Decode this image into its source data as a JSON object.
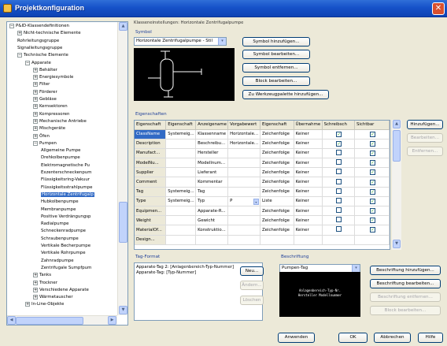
{
  "window": {
    "title": "Projektkonfiguration",
    "close_glyph": "✕"
  },
  "tree": {
    "items": [
      {
        "label": "P&ID-Klassendefinitionen",
        "level": 0,
        "expander": "−"
      },
      {
        "label": "Nicht-technische Elemente",
        "level": 1,
        "expander": "+"
      },
      {
        "label": "Rohrleitungsgruppe",
        "level": 1,
        "expander": ""
      },
      {
        "label": "Signalleitungsgruppe",
        "level": 1,
        "expander": ""
      },
      {
        "label": "Technische Elemente",
        "level": 1,
        "expander": "−"
      },
      {
        "label": "Apparate",
        "level": 2,
        "expander": "−"
      },
      {
        "label": "Behälter",
        "level": 3,
        "expander": "+"
      },
      {
        "label": "Energiesymbole",
        "level": 3,
        "expander": "+"
      },
      {
        "label": "Filter",
        "level": 3,
        "expander": "+"
      },
      {
        "label": "Förderer",
        "level": 3,
        "expander": "+"
      },
      {
        "label": "Gebläse",
        "level": 3,
        "expander": "+"
      },
      {
        "label": "Kernsektoren",
        "level": 3,
        "expander": "+"
      },
      {
        "label": "Kompressoren",
        "level": 3,
        "expander": "+"
      },
      {
        "label": "Mechanische Antriebe",
        "level": 3,
        "expander": "+"
      },
      {
        "label": "Mischgeräte",
        "level": 3,
        "expander": "+"
      },
      {
        "label": "Öfen",
        "level": 3,
        "expander": "+"
      },
      {
        "label": "Pumpen",
        "level": 3,
        "expander": "−"
      },
      {
        "label": "Allgemeine Pumpe",
        "level": 4,
        "expander": ""
      },
      {
        "label": "Drehkolbenpumpe",
        "level": 4,
        "expander": ""
      },
      {
        "label": "Elektromagnetische Pu",
        "level": 4,
        "expander": ""
      },
      {
        "label": "Exzenterschneckenpum",
        "level": 4,
        "expander": ""
      },
      {
        "label": "Flüssigkeitsring-Vakuur",
        "level": 4,
        "expander": ""
      },
      {
        "label": "Flüssigkeitsstrahlpumpe",
        "level": 4,
        "expander": ""
      },
      {
        "label": "Horizontale Zentrifugalp",
        "level": 4,
        "expander": "",
        "selected": true
      },
      {
        "label": "Hubkolbenpumpe",
        "level": 4,
        "expander": ""
      },
      {
        "label": "Membranpumpe",
        "level": 4,
        "expander": ""
      },
      {
        "label": "Positive Verdrängungsp",
        "level": 4,
        "expander": ""
      },
      {
        "label": "Radialpumpe",
        "level": 4,
        "expander": ""
      },
      {
        "label": "Schneckenradpumpe",
        "level": 4,
        "expander": ""
      },
      {
        "label": "Schraubenpumpe",
        "level": 4,
        "expander": ""
      },
      {
        "label": "Vertikale Becherpumpe",
        "level": 4,
        "expander": ""
      },
      {
        "label": "Vertikale Rohrpumpe",
        "level": 4,
        "expander": ""
      },
      {
        "label": "Zahnradpumpe",
        "level": 4,
        "expander": ""
      },
      {
        "label": "Zentrifugale Sumpfpum",
        "level": 4,
        "expander": ""
      },
      {
        "label": "Tanks",
        "level": 3,
        "expander": "+"
      },
      {
        "label": "Trockner",
        "level": 3,
        "expander": "+"
      },
      {
        "label": "Verschiedene Apparate",
        "level": 3,
        "expander": "+"
      },
      {
        "label": "Wärmetauscher",
        "level": 3,
        "expander": "+"
      },
      {
        "label": "In-Line-Objekte",
        "level": 2,
        "expander": "+"
      }
    ]
  },
  "breadcrumb": "Klasseneinstellungen: Horizontale Zentrifugalpumpe",
  "symbol": {
    "group_label": "Symbol",
    "selected": "Horizontale Zentrifugalpumpe - Stil",
    "buttons": {
      "add": "Symbol hinzufügen...",
      "edit": "Symbol bearbeiten...",
      "remove": "Symbol entfernen...",
      "block_edit": "Block bearbeiten...",
      "add_to_palette": "Zu Werkzeugpalette hinzufügen..."
    }
  },
  "properties": {
    "group_label": "Eigenschaften",
    "columns": [
      "Eigenschaft",
      "Eigenschaft",
      "Anzeigename",
      "Vorgabewert",
      "Eigenschaft",
      "Übernahme",
      "Schreibsch",
      "Sichtbar"
    ],
    "rows": [
      {
        "name": "ClassName",
        "c2": "Systemeig...",
        "c3": "Klassenname",
        "c4": "Horizontale...",
        "c5": "Zeichenfolge",
        "c6": "Keiner",
        "ro": true,
        "vis": true
      },
      {
        "name": "Description",
        "c2": "",
        "c3": "Beschreibu...",
        "c4": "Horizontale...",
        "c5": "Zeichenfolge",
        "c6": "Keiner",
        "ro": true,
        "vis": true
      },
      {
        "name": "Manufact...",
        "c2": "",
        "c3": "Hersteller",
        "c4": "",
        "c5": "Zeichenfolge",
        "c6": "Keiner",
        "ro": false,
        "vis": true
      },
      {
        "name": "ModelNu...",
        "c2": "",
        "c3": "Modellnum...",
        "c4": "",
        "c5": "Zeichenfolge",
        "c6": "Keiner",
        "ro": false,
        "vis": true
      },
      {
        "name": "Supplier",
        "c2": "",
        "c3": "Lieferant",
        "c4": "",
        "c5": "Zeichenfolge",
        "c6": "Keiner",
        "ro": false,
        "vis": true
      },
      {
        "name": "Comment",
        "c2": "",
        "c3": "Kommentar",
        "c4": "",
        "c5": "Zeichenfolge",
        "c6": "Keiner",
        "ro": false,
        "vis": true
      },
      {
        "name": "Tag",
        "c2": "Systemeig...",
        "c3": "Tag",
        "c4": "",
        "c5": "Zeichenfolge",
        "c6": "Keiner",
        "ro": false,
        "vis": true
      },
      {
        "name": "Type",
        "c2": "Systemeig...",
        "c3": "Typ",
        "c4": "P",
        "c5": "Liste",
        "c6": "Keiner",
        "ro": false,
        "vis": true
      },
      {
        "name": "Equipmen...",
        "c2": "",
        "c3": "Apparate-R...",
        "c4": "",
        "c5": "Zeichenfolge",
        "c6": "Keiner",
        "ro": false,
        "vis": true
      },
      {
        "name": "Weight",
        "c2": "",
        "c3": "Gewicht",
        "c4": "",
        "c5": "Zeichenfolge",
        "c6": "Keiner",
        "ro": false,
        "vis": true
      },
      {
        "name": "MaterialOf...",
        "c2": "",
        "c3": "Konstruktio...",
        "c4": "",
        "c5": "Zeichenfolge",
        "c6": "Keiner",
        "ro": false,
        "vis": true
      },
      {
        "name": "Design...",
        "c2": "",
        "c3": "",
        "c4": "",
        "c5": "",
        "c6": "",
        "ro": false,
        "vis": false
      }
    ],
    "buttons": {
      "add": "Hinzufügen...",
      "edit": "Bearbeiten...",
      "remove": "Entfernen..."
    }
  },
  "tag_format": {
    "group_label": "Tag-Format",
    "lines": [
      "Apparate-Tag 2: [Anlagenbereich-Typ-Nummer]",
      "Apparate-Tag: [Typ-Nummer]"
    ],
    "buttons": {
      "new": "Neu...",
      "edit": "Ändern...",
      "delete": "Löschen"
    }
  },
  "labeling": {
    "group_label": "Beschriftung",
    "selected": "Pumpen-Tag",
    "preview_lines": [
      "Anlagenbereich-Typ-Nr.",
      "Hersteller Modellnummer"
    ],
    "buttons": {
      "add": "Beschriftung hinzufügen...",
      "edit": "Beschriftung bearbeiten...",
      "remove": "Beschriftung entfernen...",
      "block_edit": "Block bearbeiten..."
    }
  },
  "footer": {
    "apply": "Anwenden",
    "ok": "OK",
    "cancel": "Abbrechen",
    "help": "Hilfe"
  },
  "icons": {
    "dropdown": "▾",
    "check": "✓",
    "up": "▲",
    "down": "▼",
    "left": "◀",
    "right": "▶"
  }
}
